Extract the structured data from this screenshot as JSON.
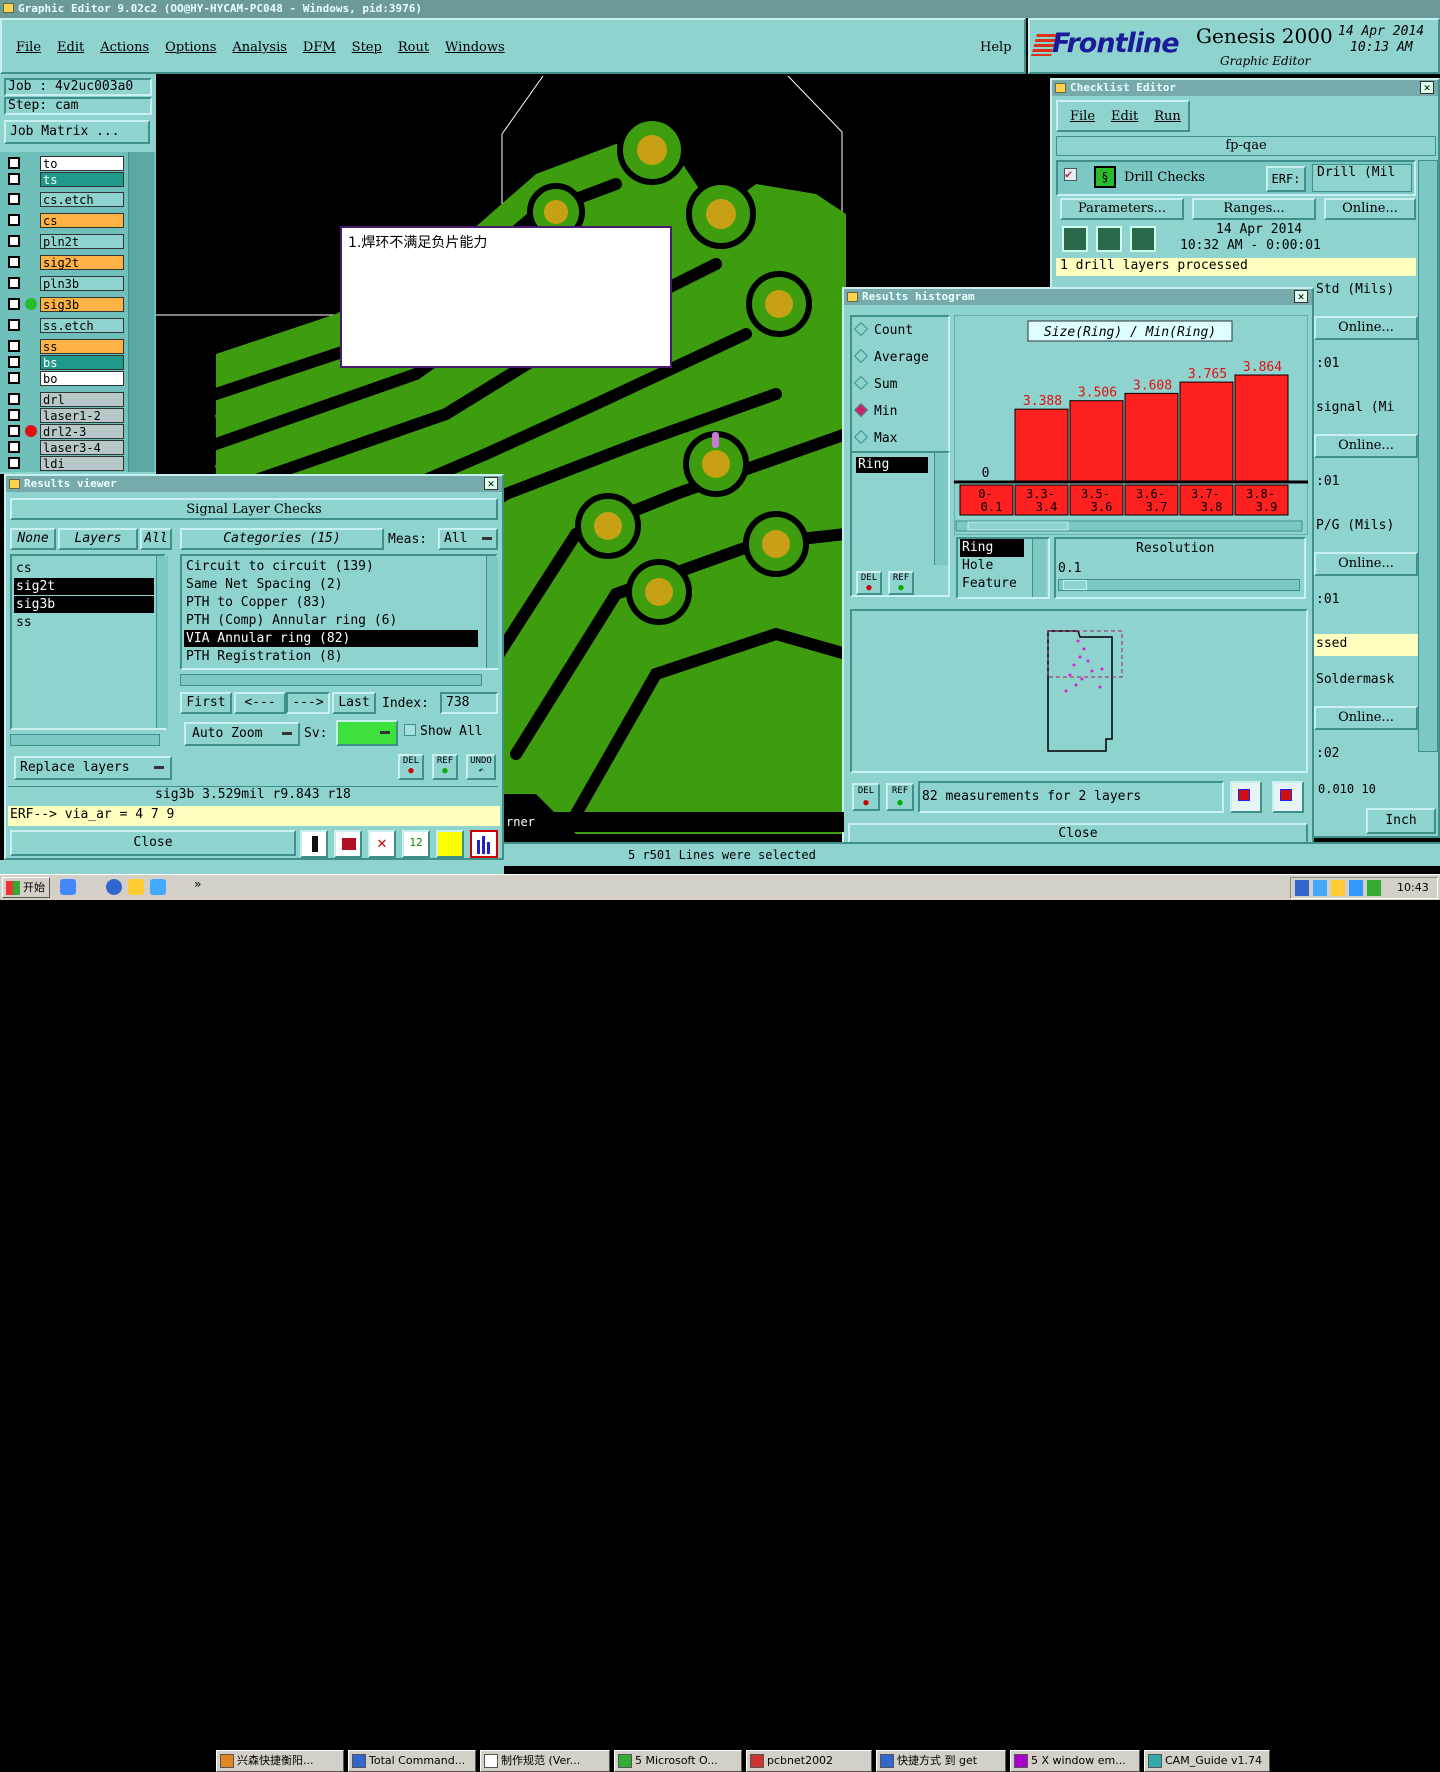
{
  "app": {
    "title": "Graphic Editor 9.02c2 (OO@HY-HYCAM-PC048 - Windows, pid:3976)",
    "menu": [
      "File",
      "Edit",
      "Actions",
      "Options",
      "Analysis",
      "DFM",
      "Step",
      "Rout",
      "Windows"
    ],
    "help": "Help",
    "brand": "Frontline",
    "product": "Genesis 2000",
    "subtitle": "Graphic Editor",
    "date": "14 Apr 2014",
    "time": "10:13 AM"
  },
  "job": {
    "job": "Job : 4v2uc003a0",
    "step": "Step: cam",
    "matrix": "Job Matrix ..."
  },
  "layers": [
    {
      "name": "to",
      "color": "#ffffff"
    },
    {
      "name": "ts",
      "color": "#1f9a8a"
    },
    {
      "name": "cs.etch",
      "color": "#8fd3cf"
    },
    {
      "name": "cs",
      "color": "#ffb347"
    },
    {
      "name": "pln2t",
      "color": "#8fd3cf"
    },
    {
      "name": "sig2t",
      "color": "#ffb347"
    },
    {
      "name": "pln3b",
      "color": "#8fd3cf"
    },
    {
      "name": "sig3b",
      "color": "#ffb347"
    },
    {
      "name": "ss.etch",
      "color": "#8fd3cf"
    },
    {
      "name": "ss",
      "color": "#ffb347"
    },
    {
      "name": "bs",
      "color": "#1f9a8a"
    },
    {
      "name": "bo",
      "color": "#ffffff"
    },
    {
      "name": "drl",
      "color": "#b8c8c8"
    },
    {
      "name": "laser1-2",
      "color": "#b8c8c8"
    },
    {
      "name": "drl2-3",
      "color": "#b8c8c8"
    },
    {
      "name": "laser3-4",
      "color": "#b8c8c8"
    },
    {
      "name": "ldi",
      "color": "#b8c8c8"
    }
  ],
  "note": "1.焊环不满足负片能力",
  "checklist": {
    "title": "Checklist Editor",
    "menu": [
      "File",
      "Edit",
      "Run"
    ],
    "name": "fp-qae",
    "action": "Drill Checks",
    "erf": "ERF:",
    "erf_value": "Drill (Mil",
    "params": "Parameters...",
    "ranges": "Ranges...",
    "online": "Online...",
    "date": "14 Apr 2014",
    "time": "10:32 AM - 0:00:01",
    "status": "1 drill layers processed",
    "right_items": [
      "Std (Mils)",
      "Online...",
      ":01",
      "signal (Mi",
      "Online...",
      ":01",
      "P/G (Mils)",
      "Online...",
      ":01",
      "ssed",
      "Soldermask",
      "Online...",
      ":02"
    ],
    "partial": "0.010 10",
    "units": "Inch"
  },
  "histogram": {
    "title": "Results histogram",
    "modes": [
      "Count",
      "Average",
      "Sum",
      "Min",
      "Max"
    ],
    "selected_mode": "Min",
    "list": [
      "Ring"
    ],
    "chart_title": "Size(Ring) / Min(Ring)",
    "measure_list": [
      "Ring",
      "Hole",
      "Feature"
    ],
    "resolution_label": "Resolution",
    "resolution": "0.1",
    "status": "82 measurements for 2 layers",
    "close": "Close",
    "del": "DEL",
    "ref": "REF"
  },
  "chart_data": {
    "type": "bar",
    "title": "Size(Ring) / Min(Ring)",
    "categories": [
      "0-0.1",
      "3.3-3.4",
      "3.5-3.6",
      "3.6-3.7",
      "3.7-3.8",
      "3.8-3.9"
    ],
    "values": [
      0,
      3.388,
      3.506,
      3.608,
      3.765,
      3.864
    ],
    "labels": [
      "0",
      "3.388",
      "3.506",
      "3.608",
      "3.765",
      "3.864"
    ],
    "bar_color": "#ff2020"
  },
  "viewer": {
    "title": "Results viewer",
    "header": "Signal Layer Checks",
    "none": "None",
    "layers": "Layers",
    "all": "All",
    "layer_list": [
      "cs",
      "sig2t",
      "sig3b",
      "ss"
    ],
    "categories_btn": "Categories (15)",
    "meas": "Meas:",
    "meas_value": "All",
    "categories": [
      "Circuit to circuit (139)",
      "Same Net Spacing (2)",
      "PTH to Copper (83)",
      "PTH (Comp) Annular ring (6)",
      "VIA Annular ring (82)",
      "PTH Registration (8)"
    ],
    "selected_category": "VIA Annular ring (82)",
    "first": "First",
    "prev": "<---",
    "next": "--->",
    "last": "Last",
    "index_label": "Index:",
    "index": "738",
    "autozoom": "Auto Zoom",
    "sv": "Sv:",
    "showall": "Show All",
    "replace": "Replace layers",
    "info": "sig3b 3.529mil   r9.843   r18",
    "erf": "ERF--> via_ar = 4 7 9",
    "close": "Close",
    "del": "DEL",
    "ref": "REF",
    "undo": "UNDO"
  },
  "status_bar": {
    "corner": "rner",
    "selected": "5 r501 Lines were selected"
  },
  "taskbar": {
    "start": "开始",
    "tasks": [
      "兴森快捷衡阳...",
      "Total Command...",
      "制作规范 (Ver...",
      "5 Microsoft O...",
      "pcbnet2002",
      "快捷方式 到 get",
      "5 X window em...",
      "CAM_Guide v1.74"
    ],
    "clock": "10:43"
  }
}
